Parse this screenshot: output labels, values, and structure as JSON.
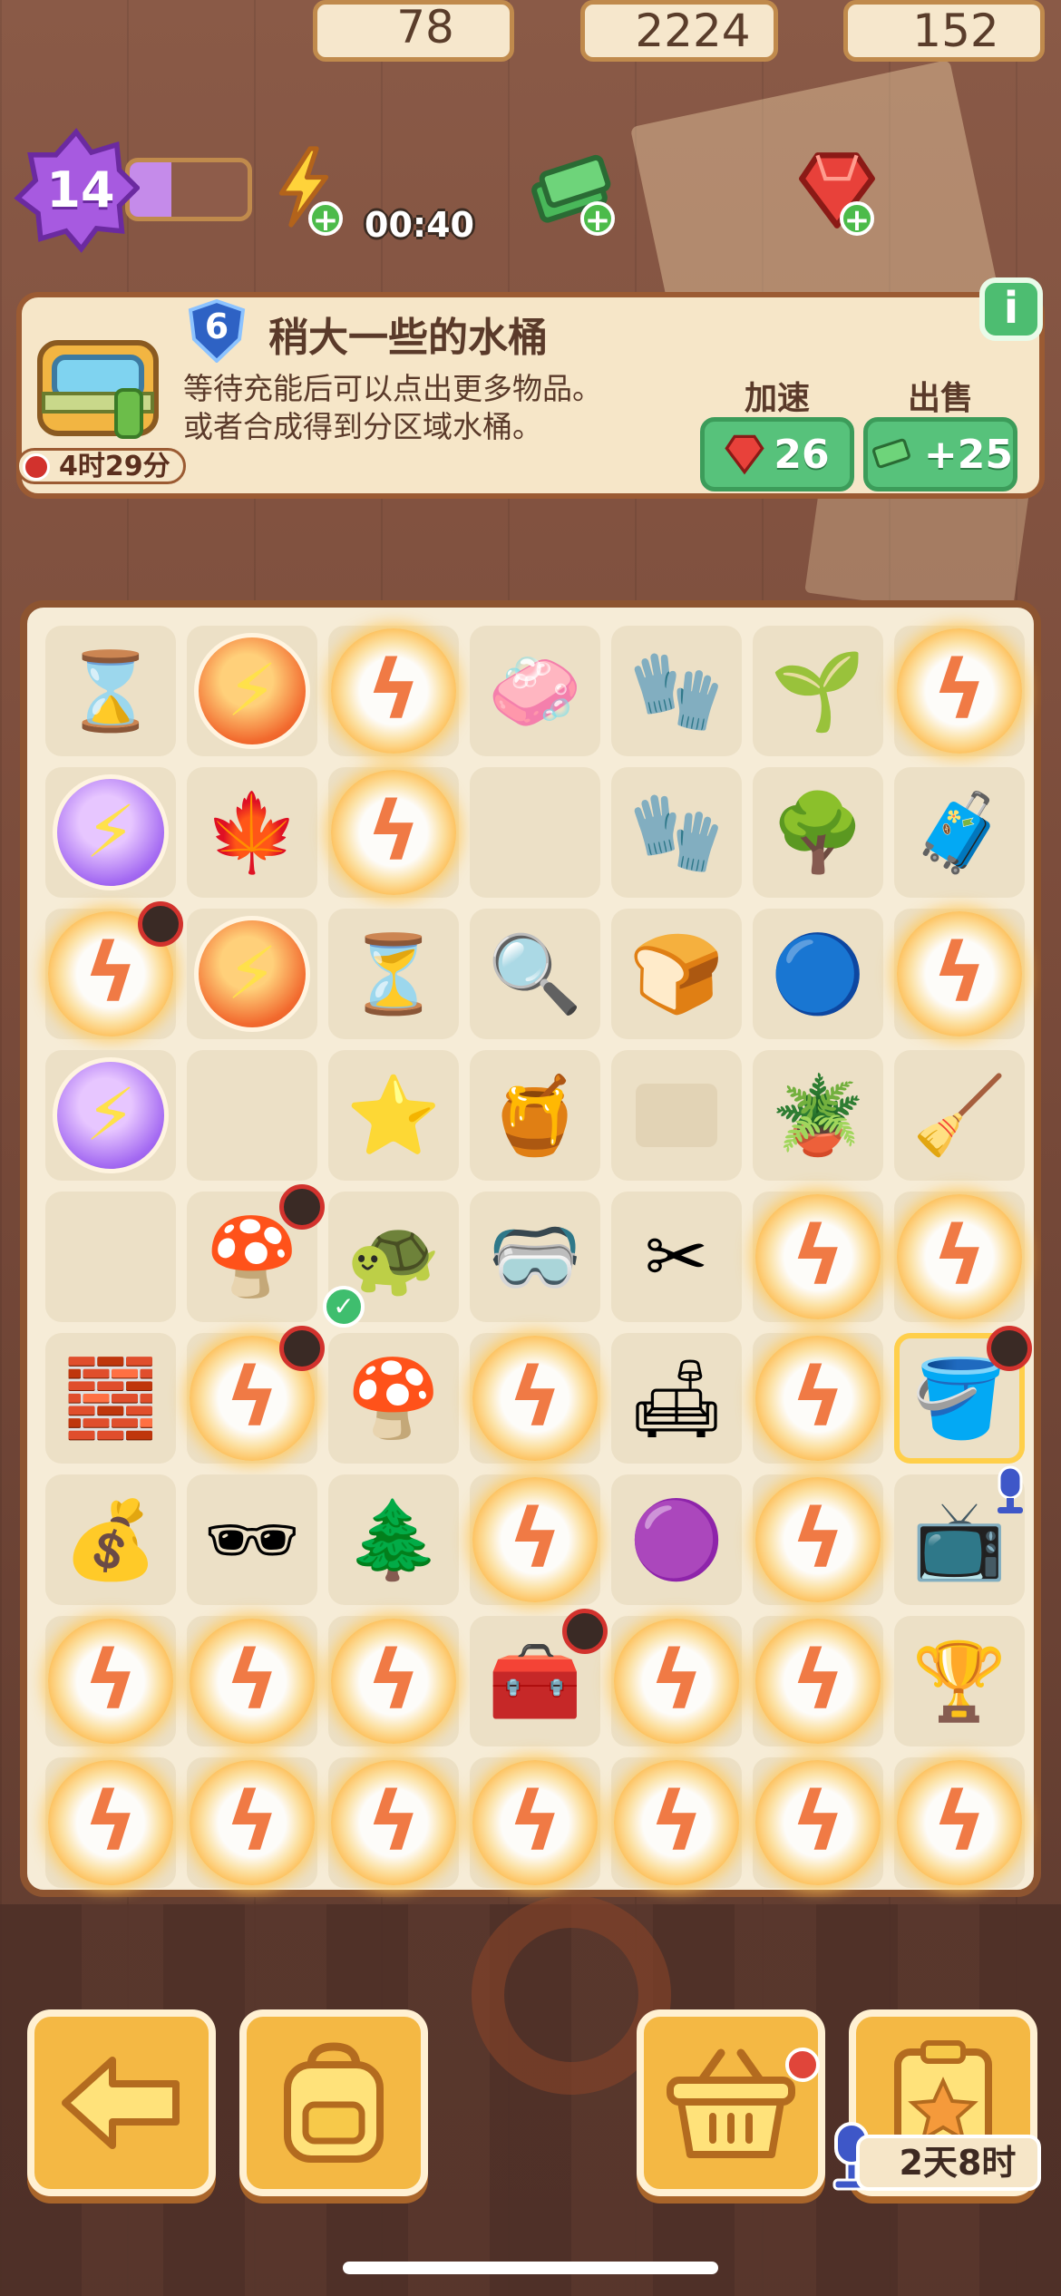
{
  "top_bar": {
    "level": "14",
    "xp_progress": 0.35,
    "energy": "78",
    "energy_timer": "00:40",
    "cash": "2224",
    "gems": "152"
  },
  "info_panel": {
    "item_level": "6",
    "item_title": "稍大一些的水桶",
    "description_line1": "等待充能后可以点出更多物品。",
    "description_line2": "或者合成得到分区域水桶。",
    "cooldown": "4时29分",
    "speedup_label": "加速",
    "speedup_cost": "26",
    "sell_label": "出售",
    "sell_value": "+25",
    "info_button": "i"
  },
  "board": {
    "rows": [
      [
        {
          "k": "hourglass-icon",
          "g": "⌛"
        },
        {
          "k": "energy-orb-icon",
          "t": "energy"
        },
        {
          "k": "locked-bubble",
          "t": "bubble"
        },
        {
          "k": "soap-icon",
          "g": "🧼"
        },
        {
          "k": "gloves-icon",
          "g": "🧤"
        },
        {
          "k": "sprout-icon",
          "g": "🌱"
        },
        {
          "k": "locked-bubble",
          "t": "bubble"
        }
      ],
      [
        {
          "k": "energy-orb-purple-icon",
          "t": "energy-purple"
        },
        {
          "k": "leaf-stencil-icon",
          "g": "🍁"
        },
        {
          "k": "locked-bubble",
          "t": "bubble"
        },
        {
          "k": "empty-cell",
          "t": "empty"
        },
        {
          "k": "work-gloves-icon",
          "g": "🧤"
        },
        {
          "k": "bonsai-sapling-icon",
          "g": "🌳"
        },
        {
          "k": "folded-cloth-icon",
          "g": "🧳"
        }
      ],
      [
        {
          "k": "locked-bubble",
          "t": "bubble",
          "clock": true
        },
        {
          "k": "energy-orb-icon",
          "t": "energy"
        },
        {
          "k": "hourglass-tile-icon",
          "g": "⏳"
        },
        {
          "k": "magnifier-icon",
          "g": "🔍"
        },
        {
          "k": "bread-icon",
          "g": "🍞"
        },
        {
          "k": "blue-gem-icon",
          "g": "🔵"
        },
        {
          "k": "locked-bubble",
          "t": "bubble"
        }
      ],
      [
        {
          "k": "energy-orb-purple-icon",
          "t": "energy-purple"
        },
        {
          "k": "empty-cell",
          "t": "empty"
        },
        {
          "k": "purple-star-slime-icon",
          "g": "⭐"
        },
        {
          "k": "honey-jar-icon",
          "g": "🍯"
        },
        {
          "k": "crown-placeholder-icon",
          "t": "empty"
        },
        {
          "k": "potted-plant-icon",
          "g": "🪴"
        },
        {
          "k": "garden-rake-icon",
          "g": "🧹"
        }
      ],
      [
        {
          "k": "empty-cell",
          "t": "empty"
        },
        {
          "k": "mushroom-lamp-icon",
          "g": "🍄",
          "clock": true
        },
        {
          "k": "turtle-cushion-icon",
          "g": "🐢",
          "check": true
        },
        {
          "k": "goggles-icon",
          "g": "🥽"
        },
        {
          "k": "pruning-shears-icon",
          "g": "✂"
        },
        {
          "k": "locked-bubble",
          "t": "bubble"
        },
        {
          "k": "locked-bubble",
          "t": "bubble"
        }
      ],
      [
        {
          "k": "wooden-blocks-icon",
          "g": "🧱"
        },
        {
          "k": "locked-bubble",
          "t": "bubble",
          "clock": true
        },
        {
          "k": "mushroom-lamp-icon",
          "g": "🍄"
        },
        {
          "k": "locked-bubble",
          "t": "bubble"
        },
        {
          "k": "grass-cushion-icon",
          "g": "🛋"
        },
        {
          "k": "locked-bubble",
          "t": "bubble"
        },
        {
          "k": "water-bucket-icon",
          "g": "🪣",
          "clock": true,
          "selected": true
        }
      ],
      [
        {
          "k": "seed-bag-icon",
          "g": "💰"
        },
        {
          "k": "sunglasses-icon",
          "g": "🕶"
        },
        {
          "k": "bonsai-tree-icon",
          "g": "🌲"
        },
        {
          "k": "locked-bubble",
          "t": "bubble"
        },
        {
          "k": "purple-slime-icon",
          "g": "🟣"
        },
        {
          "k": "locked-bubble",
          "t": "bubble"
        },
        {
          "k": "retro-tv-icon",
          "g": "📺",
          "mic": true
        }
      ],
      [
        {
          "k": "locked-bubble",
          "t": "bubble"
        },
        {
          "k": "locked-bubble",
          "t": "bubble"
        },
        {
          "k": "locked-bubble",
          "t": "bubble"
        },
        {
          "k": "toolbox-icon",
          "g": "🧰",
          "clock": true
        },
        {
          "k": "locked-bubble",
          "t": "bubble"
        },
        {
          "k": "locked-bubble",
          "t": "bubble"
        },
        {
          "k": "trophy-icon",
          "g": "🏆"
        }
      ],
      [
        {
          "k": "locked-bubble",
          "t": "bubble"
        },
        {
          "k": "locked-bubble",
          "t": "bubble"
        },
        {
          "k": "locked-bubble",
          "t": "bubble"
        },
        {
          "k": "locked-bubble",
          "t": "bubble"
        },
        {
          "k": "locked-bubble",
          "t": "bubble"
        },
        {
          "k": "locked-bubble",
          "t": "bubble"
        },
        {
          "k": "locked-bubble",
          "t": "bubble"
        }
      ]
    ]
  },
  "bottom_bar": {
    "back_icon": "arrow-left-icon",
    "backpack_icon": "backpack-icon",
    "shop_icon": "basket-icon",
    "event_icon": "star-clipboard-icon",
    "event_timer": "2天8时"
  },
  "colors": {
    "board_border": "#8d5430",
    "button_gold": "#f4b844",
    "green_button": "#57c27b",
    "level_purple": "#a75ae0"
  }
}
